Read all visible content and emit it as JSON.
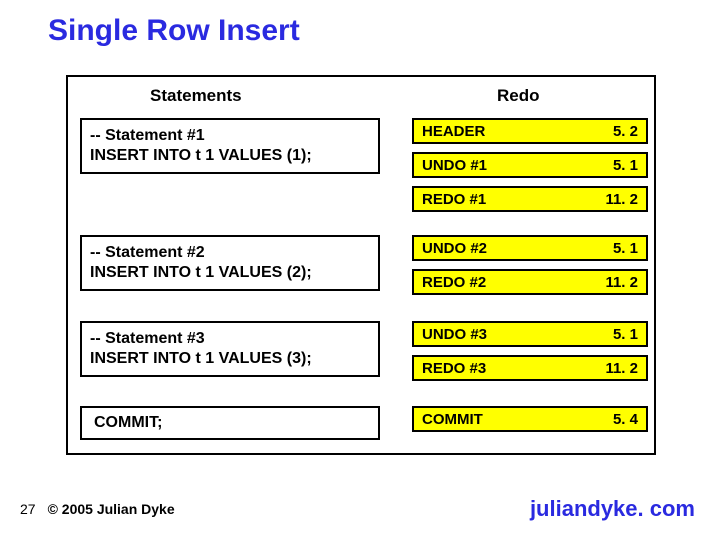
{
  "title": "Single Row Insert",
  "columns": {
    "stmts": "Statements",
    "redo": "Redo"
  },
  "stmt1": {
    "c": "-- Statement #1",
    "s": "INSERT INTO t 1 VALUES (1);"
  },
  "stmt2": {
    "c": "-- Statement #2",
    "s": "INSERT INTO t 1 VALUES (2);"
  },
  "stmt3": {
    "c": "-- Statement #3",
    "s": "INSERT INTO t 1 VALUES (3);"
  },
  "commit_stmt": "COMMIT;",
  "redo": {
    "r1": {
      "l": "HEADER",
      "v": "5. 2"
    },
    "r2": {
      "l": "UNDO #1",
      "v": "5. 1"
    },
    "r3": {
      "l": "REDO #1",
      "v": "11. 2"
    },
    "r4": {
      "l": "UNDO #2",
      "v": "5. 1"
    },
    "r5": {
      "l": "REDO #2",
      "v": "11. 2"
    },
    "r6": {
      "l": "UNDO #3",
      "v": "5. 1"
    },
    "r7": {
      "l": "REDO #3",
      "v": "11. 2"
    },
    "r8": {
      "l": "COMMIT",
      "v": "5. 4"
    }
  },
  "footer": {
    "page": "27",
    "copyright": "© 2005 Julian Dyke",
    "site": "juliandyke. com"
  }
}
